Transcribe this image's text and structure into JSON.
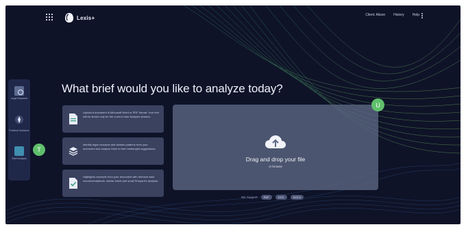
{
  "app": {
    "logo_text": "Lexis+"
  },
  "header": {
    "links": [
      "Client: Alison",
      "History",
      "Help"
    ]
  },
  "sidebar": {
    "items": [
      {
        "label": "Legal Research"
      },
      {
        "label": "Practical Guidance"
      },
      {
        "label": "Brief Analysis"
      }
    ],
    "avatar": "T"
  },
  "main": {
    "heading": "What brief would you like to analyze today?",
    "cards": [
      {
        "text": "Upload a document in Microsoft Word or PDF format. Your text will be stored only for the current User Analysis session."
      },
      {
        "text": "Identify legal concepts and citation patterns from your document and analyze them to find meaningful suggestions."
      },
      {
        "text": "Highlights concepts from your document with relevant case recommendations, similar briefs and small Shepard's analysis."
      }
    ],
    "dropzone": {
      "title": "Drag and drop your file",
      "subtitle": "or browse"
    },
    "user_avatar": "U",
    "support": {
      "label": "We Support",
      "formats": [
        "PDF",
        "DOC",
        "DOCX"
      ]
    }
  },
  "colors": {
    "background": "#0f1328",
    "accent_green": "#5fbf6b",
    "card": "#3a4260"
  }
}
